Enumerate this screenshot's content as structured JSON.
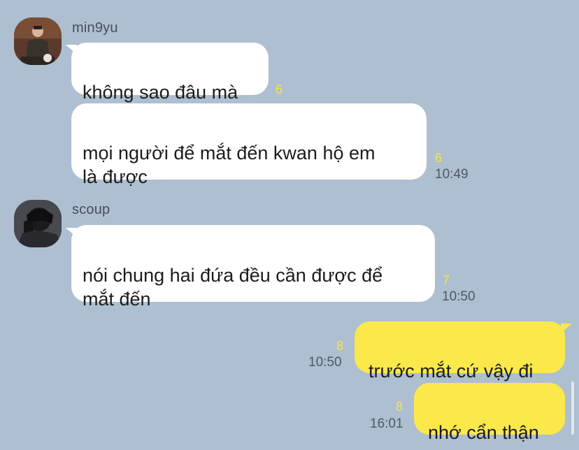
{
  "chat": {
    "groups": [
      {
        "sender": "min9yu",
        "avatar_icon": "profile-photo-min9yu",
        "messages": [
          {
            "text": "không sao đâu mà",
            "unread": "6",
            "time": ""
          },
          {
            "text": "mọi người để mắt đến kwan hộ em\nlà được",
            "unread": "6",
            "time": "10:49"
          }
        ]
      },
      {
        "sender": "scoup",
        "avatar_icon": "profile-photo-scoup",
        "messages": [
          {
            "text": "nói chung hai đứa đều cần được để\nmắt đến",
            "unread": "7",
            "time": "10:50"
          }
        ]
      }
    ],
    "outgoing": [
      {
        "text": "trước mắt cứ vậy đi",
        "unread": "8",
        "time": "10:50"
      },
      {
        "text": "nhớ cẩn thận",
        "unread": "8",
        "time": "16:01"
      }
    ]
  },
  "colors": {
    "background": "#aebfd1",
    "incoming_bubble": "#ffffff",
    "outgoing_bubble": "#fbe84b",
    "unread_count": "#f5e54a"
  }
}
